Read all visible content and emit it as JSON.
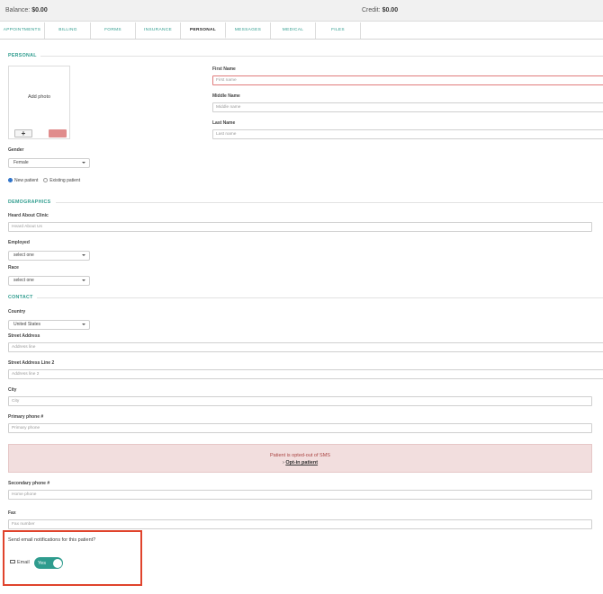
{
  "topbar": {
    "balance_label": "Balance:",
    "balance_value": "$0.00",
    "credit_label": "Credit:",
    "credit_value": "$0.00"
  },
  "tabs": [
    {
      "label": "APPOINTMENTS"
    },
    {
      "label": "BILLING"
    },
    {
      "label": "FORMS"
    },
    {
      "label": "INSURANCE"
    },
    {
      "label": "PERSONAL",
      "active": true
    },
    {
      "label": "MESSAGES"
    },
    {
      "label": "MEDICAL"
    },
    {
      "label": "FILES"
    }
  ],
  "personal": {
    "title": "PERSONAL",
    "photo_label": "Add photo",
    "add_button": "+",
    "first_name_label": "First Name",
    "first_name_placeholder": "First name",
    "middle_name_label": "Middle Name",
    "middle_name_placeholder": "Middle name",
    "last_name_label": "Last Name",
    "last_name_placeholder": "Last name",
    "gender_label": "Gender",
    "gender_value": "Female",
    "new_patient": "New patient",
    "existing_patient": "Existing patient"
  },
  "demographics": {
    "title": "DEMOGRAPHICS",
    "heard_label": "Heard About Clinic",
    "heard_placeholder": "Heard About Us",
    "employed_label": "Employed",
    "employed_value": "select one",
    "race_label": "Race",
    "race_value": "select one"
  },
  "contact": {
    "title": "CONTACT",
    "country_label": "Country",
    "country_value": "United States",
    "street_label": "Street Address",
    "street_placeholder": "Address line",
    "street2_label": "Street Address Line 2",
    "street2_placeholder": "Address line 2",
    "city_label": "City",
    "city_placeholder": "City",
    "primary_label": "Primary phone #",
    "primary_placeholder": "Primary phone",
    "alert_text": "Patient is opted-out of SMS",
    "opt_in_arrow": "›",
    "opt_in_link": "Opt-in patient",
    "secondary_label": "Secondary phone #",
    "secondary_placeholder": "Home phone",
    "fax_label": "Fax",
    "fax_placeholder": "Fax number",
    "email_question": "Send email notifications for this patient?",
    "email_label": "Email",
    "email_toggle": "Yes"
  },
  "colors": {
    "accent": "#2f9c8e",
    "alert_bg": "#f2dede",
    "highlight_box": "#e0432c"
  }
}
